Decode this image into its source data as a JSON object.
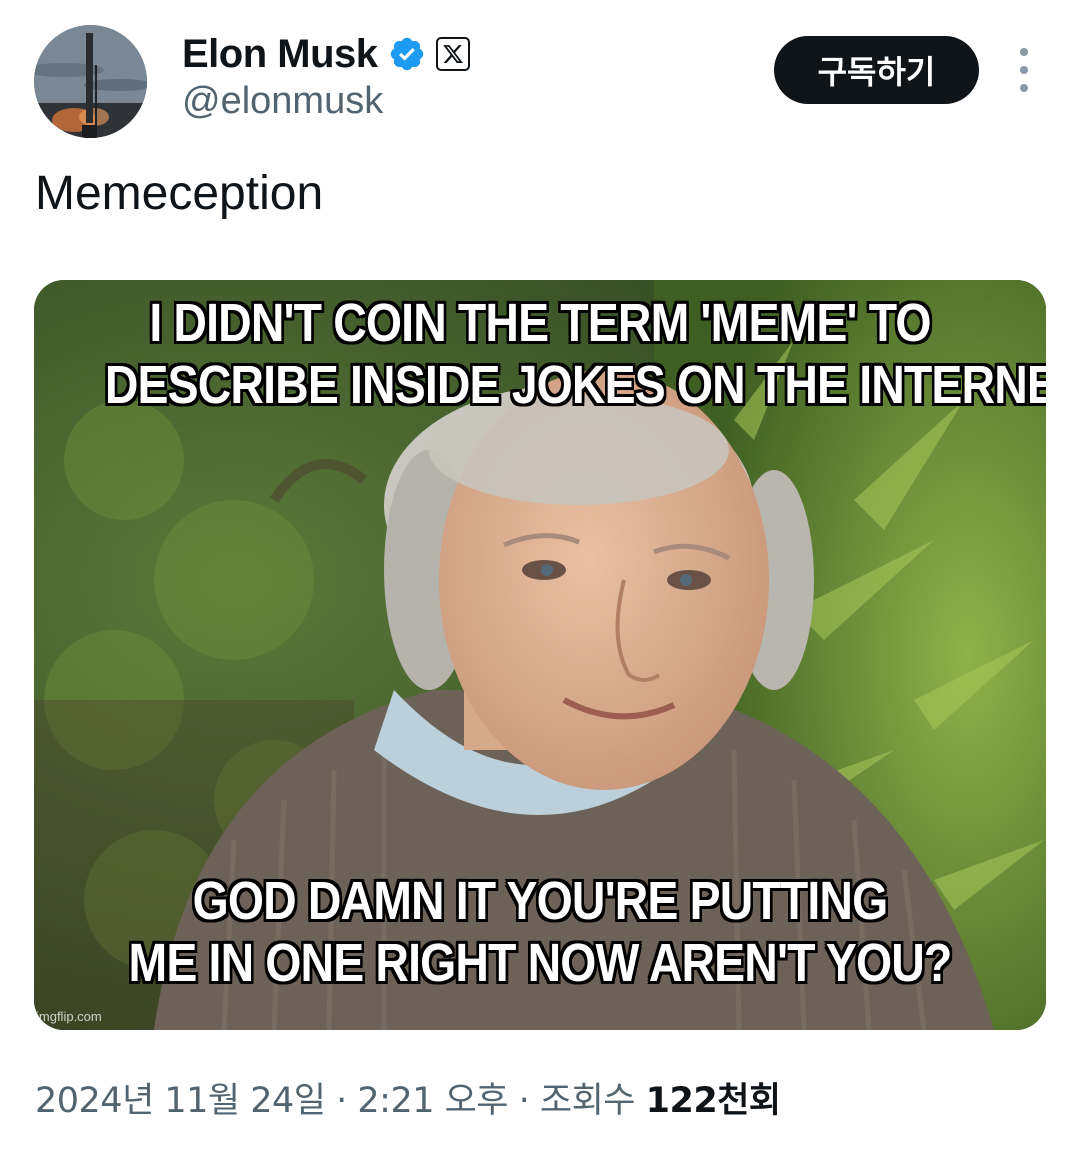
{
  "author": {
    "display_name": "Elon Musk",
    "handle": "@elonmusk",
    "verified_icon": "verified-badge-icon",
    "affiliation_icon": "x-logo-icon"
  },
  "actions": {
    "subscribe_label": "구독하기",
    "more_icon": "more-options-icon"
  },
  "tweet": {
    "text": "Memeception"
  },
  "media": {
    "top_line_1": "I DIDN'T COIN THE TERM 'MEME' TO",
    "top_line_2": "DESCRIBE INSIDE JOKES ON THE INTERNET",
    "bottom_line_1": "GOD DAMN IT YOU'RE PUTTING",
    "bottom_line_2": "ME IN ONE RIGHT NOW AREN'T YOU?",
    "watermark": "imgflip.com"
  },
  "meta": {
    "date": "2024년 11월 24일",
    "separator": " · ",
    "time": "2:21 오후",
    "views_label": "조회수",
    "views_count": "122천회"
  },
  "colors": {
    "primary_text": "#0f1419",
    "secondary_text": "#536471",
    "verified_blue": "#1d9bf0",
    "button_bg": "#0f1419"
  }
}
